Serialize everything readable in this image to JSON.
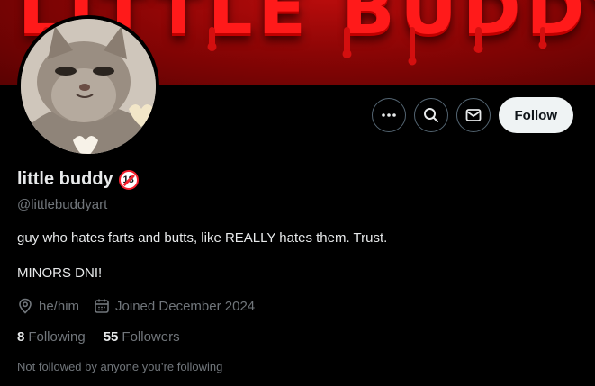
{
  "banner": {
    "text": "LITTLE BUDDY"
  },
  "profile": {
    "name": "little buddy",
    "age_badge": "18",
    "handle": "@littlebuddyart_",
    "bio_line1": "guy who hates farts and butts, like REALLY hates them. Trust.",
    "bio_line2": "MINORS DNI!",
    "pronouns": "he/him",
    "joined": "Joined December 2024",
    "following_count": "8",
    "following_label": "Following",
    "followers_count": "55",
    "followers_label": "Followers",
    "followed_by": "Not followed by anyone you’re following"
  },
  "actions": {
    "follow_label": "Follow"
  },
  "icons": {
    "more": "more-dots-icon",
    "search": "search-icon",
    "message": "envelope-icon",
    "location": "location-pin-icon",
    "calendar": "calendar-icon"
  },
  "colors": {
    "banner_red": "#8a0505",
    "badge_red": "#f4212e",
    "muted": "#71767b"
  }
}
